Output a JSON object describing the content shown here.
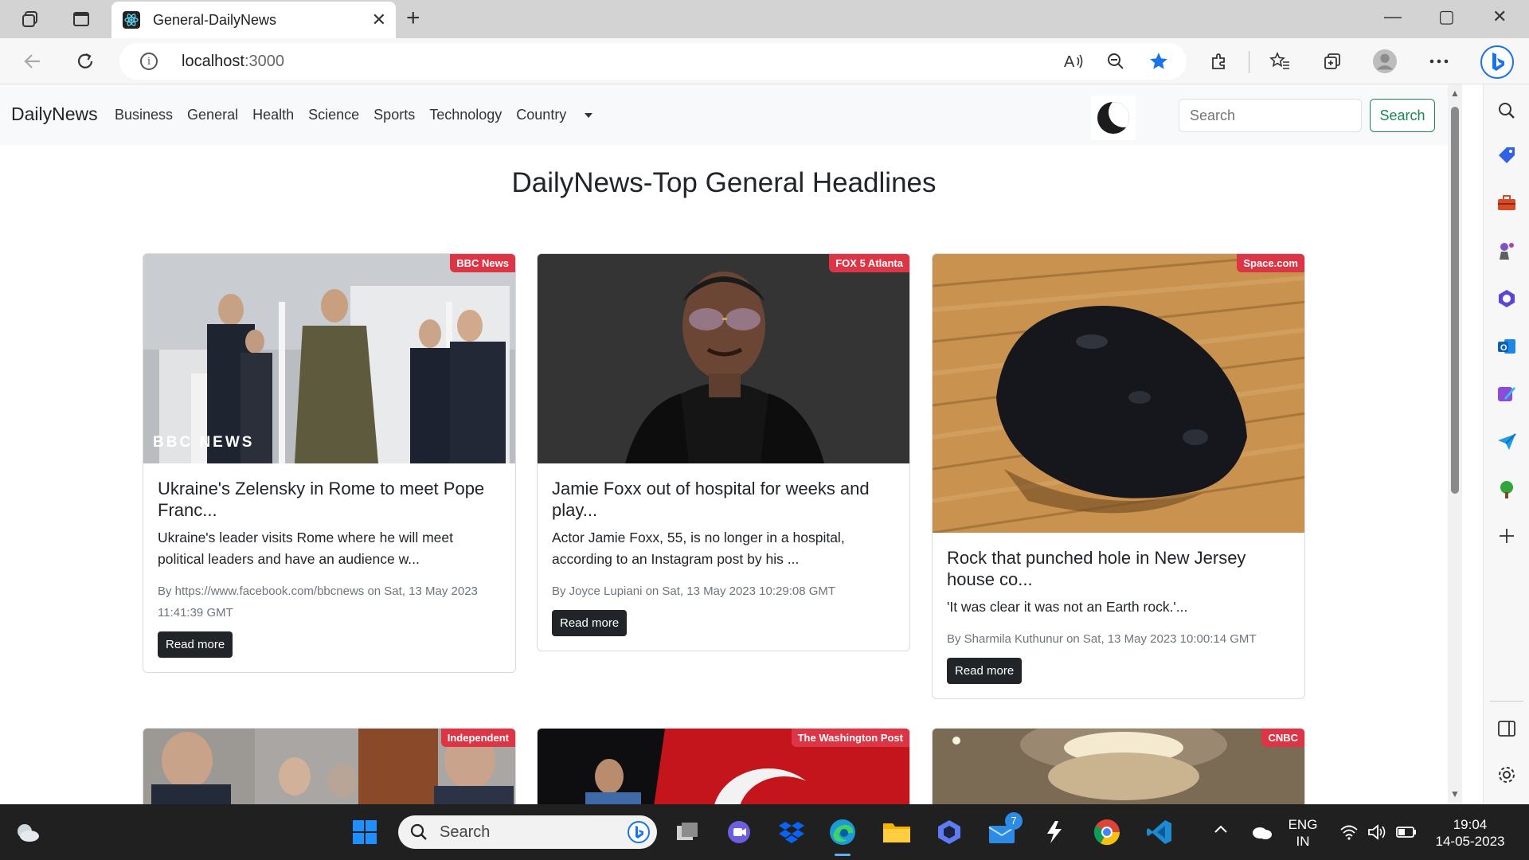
{
  "browser": {
    "tab_title": "General-DailyNews",
    "tab_close": "✕",
    "new_tab": "+",
    "url_host": "localhost",
    "url_port": ":3000",
    "read_aloud": "A̒",
    "window_min": "—",
    "window_max": "▢",
    "window_close": "✕"
  },
  "navbar": {
    "brand": "DailyNews",
    "links": [
      "Business",
      "General",
      "Health",
      "Science",
      "Sports",
      "Technology"
    ],
    "country_label": "Country",
    "search_placeholder": "Search",
    "search_button": "Search"
  },
  "page_heading": "DailyNews-Top General Headlines",
  "cards": [
    {
      "source": "BBC News",
      "title": "Ukraine's Zelensky in Rome to meet Pope Franc...",
      "description": "Ukraine's leader visits Rome where he will meet political leaders and have an audience w...",
      "meta": "By https://www.facebook.com/bbcnews on Sat, 13 May 2023 11:41:39 GMT",
      "button": "Read more",
      "watermark": "BBC NEWS"
    },
    {
      "source": "FOX 5 Atlanta",
      "title": "Jamie Foxx out of hospital for weeks and play...",
      "description": "Actor Jamie Foxx, 55, is no longer in a hospital, according to an Instagram post by his ...",
      "meta": "By Joyce Lupiani on Sat, 13 May 2023 10:29:08 GMT",
      "button": "Read more"
    },
    {
      "source": "Space.com",
      "title": "Rock that punched hole in New Jersey house co...",
      "description": "'It was clear it was not an Earth rock.'...",
      "meta": "By Sharmila Kuthunur on Sat, 13 May 2023 10:00:14 GMT",
      "button": "Read more"
    },
    {
      "source": "Independent"
    },
    {
      "source": "The Washington Post"
    },
    {
      "source": "CNBC"
    }
  ],
  "taskbar": {
    "search_label": "Search",
    "mail_badge": "7",
    "lang_line1": "ENG",
    "lang_line2": "IN",
    "time": "19:04",
    "date": "14-05-2023"
  },
  "colors": {
    "badge": "#dc3545",
    "search_button": "#198754",
    "read_more": "#212529",
    "edge_accent": "#1a73e8"
  }
}
